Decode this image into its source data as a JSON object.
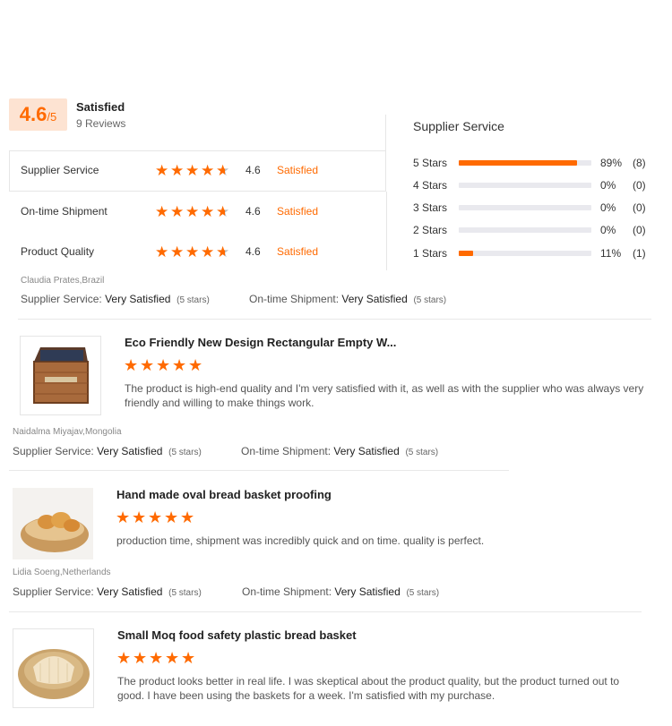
{
  "summary": {
    "score": "4.6",
    "out_of": "/5",
    "label": "Satisfied",
    "reviews": "9 Reviews"
  },
  "ratings": [
    {
      "name": "Supplier Service",
      "value": "4.6",
      "label": "Satisfied"
    },
    {
      "name": "On-time Shipment",
      "value": "4.6",
      "label": "Satisfied"
    },
    {
      "name": "Product Quality",
      "value": "4.6",
      "label": "Satisfied"
    }
  ],
  "breakdown": {
    "title": "Supplier Service",
    "rows": [
      {
        "label": "5 Stars",
        "percent": "89%",
        "count": "(8)",
        "fraction": 0.89
      },
      {
        "label": "4 Stars",
        "percent": "0%",
        "count": "(0)",
        "fraction": 0
      },
      {
        "label": "3 Stars",
        "percent": "0%",
        "count": "(0)",
        "fraction": 0
      },
      {
        "label": "2 Stars",
        "percent": "0%",
        "count": "(0)",
        "fraction": 0
      },
      {
        "label": "1 Stars",
        "percent": "11%",
        "count": "(1)",
        "fraction": 0.11
      }
    ]
  },
  "reviews": [
    {
      "author": "Claudia Prates,Brazil",
      "supplier_label": "Supplier Service:",
      "supplier_value": "Very Satisfied",
      "supplier_stars": "(5 stars)",
      "shipment_label": "On-time Shipment:",
      "shipment_value": "Very Satisfied",
      "shipment_stars": "(5 stars)",
      "product_title": "Eco Friendly New Design Rectangular Empty W...",
      "text": "The product is high-end quality and I'm very satisfied with it, as well as with the supplier who was always very friendly and willing to make things work."
    },
    {
      "author": "Naidalma Miyajav,Mongolia",
      "supplier_label": "Supplier Service:",
      "supplier_value": "Very Satisfied",
      "supplier_stars": "(5 stars)",
      "shipment_label": "On-time Shipment:",
      "shipment_value": "Very Satisfied",
      "shipment_stars": "(5 stars)",
      "product_title": "Hand made oval bread basket proofing",
      "text": "production time, shipment was incredibly quick and on time. quality is perfect."
    },
    {
      "author": "Lidia Soeng,Netherlands",
      "supplier_label": "Supplier Service:",
      "supplier_value": "Very Satisfied",
      "supplier_stars": "(5 stars)",
      "shipment_label": "On-time Shipment:",
      "shipment_value": "Very Satisfied",
      "shipment_stars": "(5 stars)",
      "product_title": "Small Moq food safety plastic bread basket",
      "text": "The product looks better in real life. I was skeptical about the product quality, but the product turned out to good. I have been using the baskets for a week. I'm satisfied with my purchase."
    }
  ],
  "icons": {
    "star": "star-icon"
  },
  "colors": {
    "accent": "#ff6a00"
  }
}
